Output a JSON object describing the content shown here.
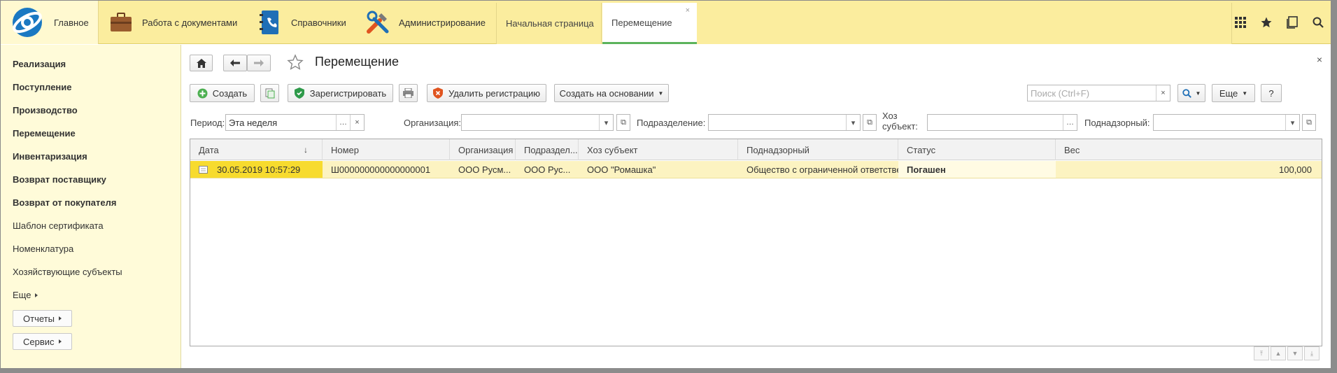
{
  "topbar": {
    "main_label": "Главное",
    "docs_label": "Работа с документами",
    "ref_label": "Справочники",
    "admin_label": "Администрирование"
  },
  "tabs": {
    "home": "Начальная страница",
    "move": "Перемещение",
    "close": "×"
  },
  "sidebar": {
    "items": [
      "Реализация",
      "Поступление",
      "Производство",
      "Перемещение",
      "Инвентаризация",
      "Возврат поставщику",
      "Возврат от покупателя",
      "Шаблон сертификата",
      "Номенклатура",
      "Хозяйствующие субъекты",
      "Еще"
    ],
    "reports": "Отчеты",
    "service": "Сервис"
  },
  "form": {
    "title": "Перемещение",
    "close": "×",
    "create": "Создать",
    "register": "Зарегистрировать",
    "delete_reg": "Удалить регистрацию",
    "create_based": "Создать на основании",
    "search_placeholder": "Поиск (Ctrl+F)",
    "more": "Еще",
    "help": "?"
  },
  "filters": {
    "period_label": "Период:",
    "period_value": "Эта неделя",
    "org_label": "Организация:",
    "org_value": "",
    "dept_label": "Подразделение:",
    "dept_value": "",
    "subj_label": "Хоз субъект:",
    "subj_value": "",
    "supervised_label": "Поднадзорный:",
    "supervised_value": ""
  },
  "grid": {
    "columns": [
      "Дата",
      "Номер",
      "Организация",
      "Подраздел...",
      "Хоз субъект",
      "Поднадзорный",
      "Статус",
      "Вес"
    ],
    "rows": [
      {
        "date": "30.05.2019 10:57:29",
        "number": "Ш000000000000000001",
        "org": "ООО Русм...",
        "dept": "ООО Рус...",
        "subject": "ООО \"Ромашка\"",
        "supervised": "Общество с ограниченной ответственн...",
        "status": "Погашен",
        "weight": "100,000"
      }
    ]
  },
  "colors": {
    "topbar_bg": "#fbed9e",
    "sidebar_bg": "#fffbd9",
    "selected_row": "#fcf3c1",
    "selected_cell": "#f7db2e",
    "active_tab_underline": "#5bb35b"
  }
}
